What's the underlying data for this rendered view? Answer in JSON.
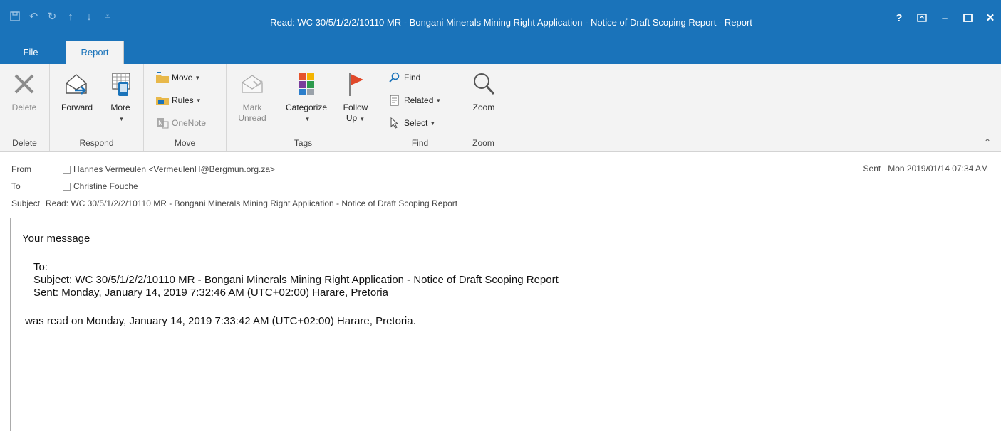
{
  "window": {
    "title": "Read: WC 30/5/1/2/2/10110 MR - Bongani Minerals Mining Right Application - Notice of Draft Scoping Report  -  Report",
    "quick_access": [
      "save-icon",
      "undo-icon",
      "redo-icon",
      "up-arrow-icon",
      "down-arrow-icon",
      "customize-icon"
    ],
    "controls": {
      "help": "?",
      "ribbon_display": "ribbon-display-icon",
      "minimize": "–",
      "maximize": "☐",
      "close": "✕"
    }
  },
  "tabs": {
    "file": "File",
    "report": "Report"
  },
  "ribbon": {
    "groups": {
      "delete": "Delete",
      "respond": "Respond",
      "move": "Move",
      "tags": "Tags",
      "find": "Find",
      "zoom": "Zoom"
    },
    "buttons": {
      "delete": "Delete",
      "forward": "Forward",
      "more": "More",
      "move": "Move",
      "rules": "Rules",
      "onenote": "OneNote",
      "mark_unread_1": "Mark",
      "mark_unread_2": "Unread",
      "categorize": "Categorize",
      "follow_up_1": "Follow",
      "follow_up_2": "Up",
      "find": "Find",
      "related": "Related",
      "select": "Select",
      "zoom": "Zoom"
    }
  },
  "message": {
    "from_label": "From",
    "from_value": "Hannes Vermeulen <VermeulenH@Bergmun.org.za>",
    "to_label": "To",
    "to_value": "Christine Fouche",
    "subject_label": "Subject",
    "subject_value": "Read: WC 30/5/1/2/2/10110 MR - Bongani Minerals Mining Right Application - Notice of Draft Scoping Report",
    "sent_label": "Sent",
    "sent_value": "Mon 2019/01/14 07:34 AM"
  },
  "body": {
    "line1": "Your message",
    "line2": "To:",
    "line3": "Subject: WC 30/5/1/2/2/10110 MR - Bongani Minerals Mining Right Application - Notice of Draft Scoping Report",
    "line4": "Sent: Monday, January 14, 2019 7:32:46 AM (UTC+02:00) Harare, Pretoria",
    "line5": "was read on Monday, January 14, 2019 7:33:42 AM (UTC+02:00) Harare, Pretoria."
  },
  "colors": {
    "accent": "#1a73ba",
    "ribbon_bg": "#f3f3f3",
    "follow_flag": "#e0492a"
  }
}
